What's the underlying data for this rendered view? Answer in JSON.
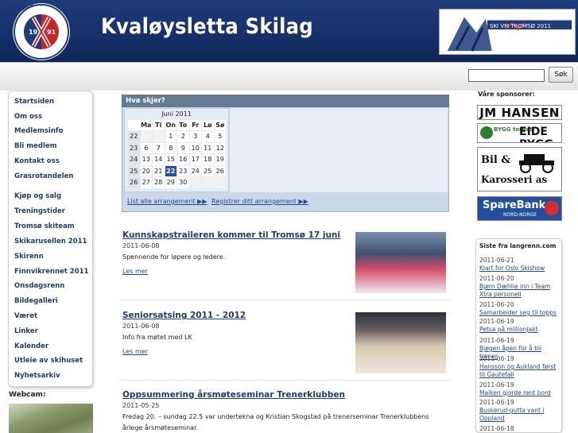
{
  "header": {
    "site_title": "Kvaløysletta Skilag",
    "logo_text": "KVALØYSLETTA SKILAG 1991",
    "banner_text": "SKI VM TROMSØ 2011"
  },
  "search": {
    "placeholder": "",
    "button_label": "Søk"
  },
  "nav": {
    "items": [
      "Startsiden",
      "Om oss",
      "Medlemsinfo",
      "Bli medlem",
      "Kontakt oss",
      "Grasrotandelen",
      "Kjøp og salg",
      "Treningstider",
      "Tromsø skiteam",
      "Skikarusellen 2011",
      "Skirenn",
      "Finnvikrennet 2011",
      "Onsdagsrenn",
      "Bildegalleri",
      "Været",
      "Linker",
      "Kalender",
      "Utleie av skihuset",
      "Nyhetsarkiv"
    ],
    "webcam_label": "Webcam:"
  },
  "events": {
    "heading": "Hva skjer?",
    "calendar": {
      "month": "Juni 2011",
      "weekdays": [
        "Ma",
        "Ti",
        "On",
        "To",
        "Fr",
        "Lø",
        "Sø"
      ],
      "weeks": [
        {
          "wk": "22",
          "days": [
            "",
            "",
            "1",
            "2",
            "3",
            "4",
            "5"
          ]
        },
        {
          "wk": "23",
          "days": [
            "6",
            "7",
            "8",
            "9",
            "10",
            "11",
            "12"
          ]
        },
        {
          "wk": "24",
          "days": [
            "13",
            "14",
            "15",
            "16",
            "17",
            "18",
            "19"
          ]
        },
        {
          "wk": "25",
          "days": [
            "20",
            "21",
            "22",
            "23",
            "24",
            "25",
            "26"
          ]
        },
        {
          "wk": "26",
          "days": [
            "27",
            "28",
            "29",
            "30",
            "",
            "",
            ""
          ]
        }
      ],
      "today": "22"
    },
    "list_all_label": "List alle arrangement ▶▶",
    "register_label": "Registrer ditt arrangement ▶▶"
  },
  "articles": [
    {
      "title": "Kunnskapstraileren kommer til Tromsø 17 juni",
      "date": "2011-06-08",
      "text": "Spennende for løpere og ledere.",
      "more": "Les mer"
    },
    {
      "title": "Seniorsatsing 2011 - 2012",
      "date": "2011-06-08",
      "text": "Info fra møtet med LK",
      "more": "Les mer"
    },
    {
      "title": "Oppsummering årsmøteseminar Trenerklubben",
      "date": "2011-05-25",
      "text": "Fredag 20. – sundag 22.5 var undertekna og Kristian Skogstad på trenerseminar Trenerklubbens årlege årsmøteseminar."
    }
  ],
  "sponsors": {
    "label": "Våre sponsorer:",
    "names": [
      "JM HANSEN",
      "BYGG torget",
      "EIDE BYGG",
      "Bil &",
      "Karosseri as",
      "SpareBank",
      "NORD-NORGE"
    ]
  },
  "latest": {
    "heading": "Siste fra langrenn.com",
    "items": [
      {
        "date": "2011-06-21",
        "title": "Klart for Oslo Skishow"
      },
      {
        "date": "2011-06-20",
        "title": "Bjørn Dæhlie inn i Team Xtra personell"
      },
      {
        "date": "2011-06-20",
        "title": "Samarbeider seg til topps"
      },
      {
        "date": "2011-06-19",
        "title": "Petsa på millionjakt"
      },
      {
        "date": "2011-06-19",
        "title": "Bjøgen åpen for å bli trener"
      },
      {
        "date": "2011-06-19",
        "title": "Hansson og Aukland først til Gautefall"
      },
      {
        "date": "2011-06-19",
        "title": "Maiken gjorde rent bord"
      },
      {
        "date": "2011-06-19",
        "title": "Buskerud-gutta vant i Oppland"
      },
      {
        "date": "2011-06-18",
        "title": ""
      }
    ]
  },
  "colors": {
    "header_blue": "#16306a",
    "link_blue": "#1f3b73",
    "events_bg": "#c8d8e8",
    "today_cell": "#2a4f9e"
  }
}
